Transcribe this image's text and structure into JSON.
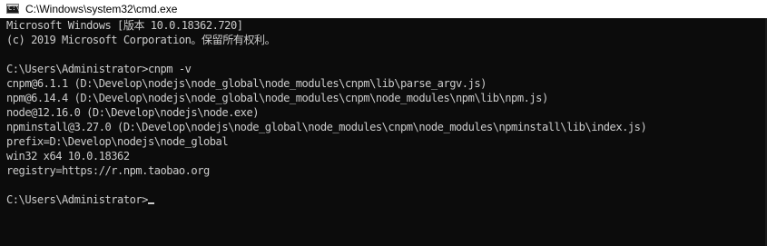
{
  "window": {
    "title": "C:\\Windows\\system32\\cmd.exe",
    "icon": "cmd-icon"
  },
  "console": {
    "lines": [
      "Microsoft Windows [版本 10.0.18362.720]",
      "(c) 2019 Microsoft Corporation。保留所有权利。",
      "",
      "C:\\Users\\Administrator>cnpm -v",
      "cnpm@6.1.1 (D:\\Develop\\nodejs\\node_global\\node_modules\\cnpm\\lib\\parse_argv.js)",
      "npm@6.14.4 (D:\\Develop\\nodejs\\node_global\\node_modules\\cnpm\\node_modules\\npm\\lib\\npm.js)",
      "node@12.16.0 (D:\\Develop\\nodejs\\node.exe)",
      "npminstall@3.27.0 (D:\\Develop\\nodejs\\node_global\\node_modules\\cnpm\\node_modules\\npminstall\\lib\\index.js)",
      "prefix=D:\\Develop\\nodejs\\node_global",
      "win32 x64 10.0.18362",
      "registry=https://r.npm.taobao.org",
      "",
      "C:\\Users\\Administrator>"
    ]
  },
  "colors": {
    "console_background": "#0c0c0c",
    "console_text": "#cccccc",
    "titlebar_background": "#ffffff"
  }
}
